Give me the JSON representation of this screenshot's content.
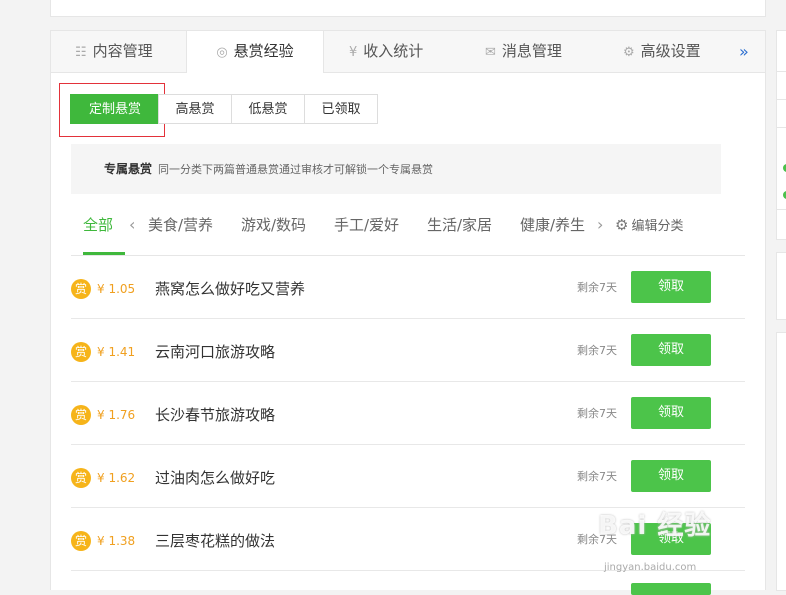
{
  "tabs": [
    {
      "label": "内容管理",
      "icon": "list-icon"
    },
    {
      "label": "悬赏经验",
      "icon": "reward-icon"
    },
    {
      "label": "收入统计",
      "icon": "yen-icon"
    },
    {
      "label": "消息管理",
      "icon": "mail-icon"
    },
    {
      "label": "高级设置",
      "icon": "gear-icon"
    }
  ],
  "tab_more": "»",
  "filters": [
    "定制悬赏",
    "高悬赏",
    "低悬赏",
    "已领取"
  ],
  "info": {
    "title": "专属悬赏",
    "desc": "同一分类下两篇普通悬赏通过审核才可解锁一个专属悬赏"
  },
  "categories": [
    "全部",
    "美食/营养",
    "游戏/数码",
    "手工/爱好",
    "生活/家居",
    "健康/养生"
  ],
  "edit_category": "编辑分类",
  "rows": [
    {
      "badge": "赏",
      "price": "¥ 1.05",
      "title": "燕窝怎么做好吃又营养",
      "remaining": "剩余7天",
      "button": "领取"
    },
    {
      "badge": "赏",
      "price": "¥ 1.41",
      "title": "云南河口旅游攻略",
      "remaining": "剩余7天",
      "button": "领取"
    },
    {
      "badge": "赏",
      "price": "¥ 1.76",
      "title": "长沙春节旅游攻略",
      "remaining": "剩余7天",
      "button": "领取"
    },
    {
      "badge": "赏",
      "price": "¥ 1.62",
      "title": "过油肉怎么做好吃",
      "remaining": "剩余7天",
      "button": "领取"
    },
    {
      "badge": "赏",
      "price": "¥ 1.38",
      "title": "三层枣花糕的做法",
      "remaining": "剩余7天",
      "button": "领取"
    }
  ],
  "watermark": {
    "text": "Bai 经验",
    "url": "jingyan.baidu.com"
  },
  "colors": {
    "accent": "#3fb83c",
    "price": "#f0a020",
    "badge": "#f6b41a",
    "highlight": "#e3323a"
  }
}
